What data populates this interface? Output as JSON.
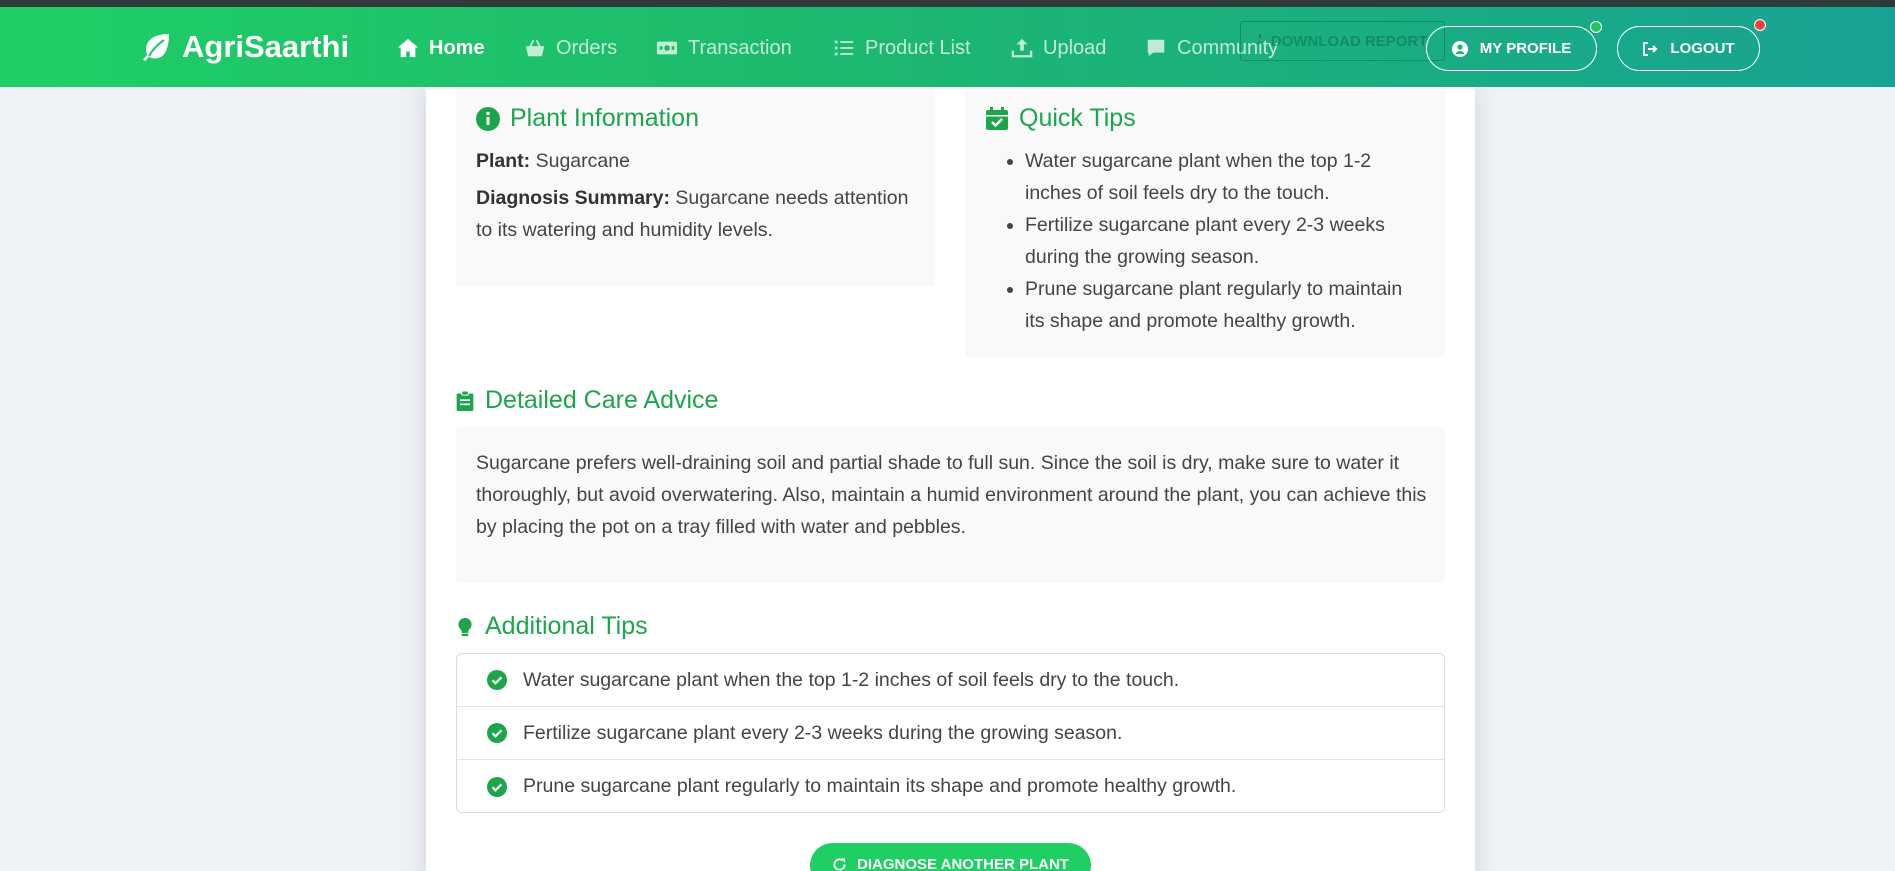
{
  "brand": {
    "name": "AgriSaarthi",
    "logo_icon": "leaf-icon"
  },
  "nav": {
    "items": [
      {
        "label": "Home",
        "icon": "home-icon",
        "active": true
      },
      {
        "label": "Orders",
        "icon": "basket-icon",
        "active": false
      },
      {
        "label": "Transaction",
        "icon": "money-bill-icon",
        "active": false
      },
      {
        "label": "Product List",
        "icon": "list-icon",
        "active": false
      },
      {
        "label": "Upload",
        "icon": "upload-icon",
        "active": false
      },
      {
        "label": "Community",
        "icon": "comment-icon",
        "active": false
      }
    ],
    "download_report_label": "DOWNLOAD REPORT",
    "profile_label": "MY PROFILE",
    "logout_label": "LOGOUT",
    "profile_status_color": "#22c55e",
    "logout_status_color": "#ef4444"
  },
  "plant_info": {
    "title": "Plant Information",
    "plant_label": "Plant:",
    "plant_value": "Sugarcane",
    "summary_label": "Diagnosis Summary:",
    "summary_value": "Sugarcane needs attention to its watering and humidity levels."
  },
  "quick_tips": {
    "title": "Quick Tips",
    "items": [
      "Water sugarcane plant when the top 1-2 inches of soil feels dry to the touch.",
      "Fertilize sugarcane plant every 2-3 weeks during the growing season.",
      "Prune sugarcane plant regularly to maintain its shape and promote healthy growth."
    ]
  },
  "care_advice": {
    "title": "Detailed Care Advice",
    "text": "Sugarcane prefers well-draining soil and partial shade to full sun. Since the soil is dry, make sure to water it thoroughly, but avoid overwatering. Also, maintain a humid environment around the plant, you can achieve this by placing the pot on a tray filled with water and pebbles."
  },
  "additional_tips": {
    "title": "Additional Tips",
    "items": [
      "Water sugarcane plant when the top 1-2 inches of soil feels dry to the touch.",
      "Fertilize sugarcane plant every 2-3 weeks during the growing season.",
      "Prune sugarcane plant regularly to maintain its shape and promote healthy growth."
    ]
  },
  "actions": {
    "diagnose_another_label": "DIAGNOSE ANOTHER PLANT"
  },
  "colors": {
    "accent": "#1da54c",
    "nav_start": "#1fcf64",
    "nav_end": "#17a394"
  }
}
